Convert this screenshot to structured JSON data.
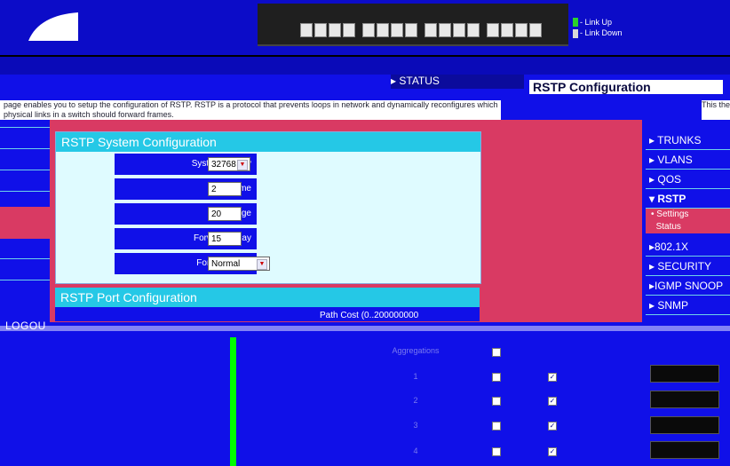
{
  "header": {
    "brand": "",
    "switch_model": "",
    "legend": {
      "link_up": "- Link Up",
      "link_down": "- Link Down"
    }
  },
  "tabs": {
    "status": "STATUS"
  },
  "page": {
    "title": "RSTP Configuration",
    "description_left": "page enables you to setup the configuration of RSTP. RSTP is a protocol that prevents loops in network and dynamically reconfigures which physical links in a switch should forward frames.",
    "description_right": "This the"
  },
  "system_config": {
    "title": "RSTP System Configuration",
    "fields": [
      {
        "label": "System Priority",
        "value": "32768",
        "type": "select"
      },
      {
        "label": "Hello Time",
        "value": "2",
        "type": "input"
      },
      {
        "label": "Max Age",
        "value": "20",
        "type": "input"
      },
      {
        "label": "Forward Delay",
        "value": "15",
        "type": "input"
      },
      {
        "label": "Force Version",
        "value": "Normal",
        "type": "select"
      }
    ]
  },
  "port_config": {
    "title": "RSTP Port Configuration",
    "path_cost_header": "Path Cost (0..200000000",
    "rows": [
      {
        "port": "Aggregations",
        "enabled": false,
        "edge": false,
        "cost": ""
      },
      {
        "port": "1",
        "enabled": false,
        "edge": true,
        "cost": ""
      },
      {
        "port": "2",
        "enabled": false,
        "edge": true,
        "cost": ""
      },
      {
        "port": "3",
        "enabled": false,
        "edge": true,
        "cost": ""
      },
      {
        "port": "4",
        "enabled": false,
        "edge": true,
        "cost": ""
      }
    ]
  },
  "nav": {
    "items": [
      {
        "label": "TRUNKS"
      },
      {
        "label": "VLANS"
      },
      {
        "label": "QOS"
      },
      {
        "label": "RSTP"
      },
      {
        "label": "802.1X"
      },
      {
        "label": "SECURITY"
      },
      {
        "label": "IGMP SNOOP"
      },
      {
        "label": "SNMP"
      }
    ],
    "sub_items": [
      {
        "label": "Settings"
      },
      {
        "label": "Status"
      }
    ]
  },
  "logout": "LOGOU",
  "colors": {
    "accent": "#25c8e6",
    "pink": "#d93a63",
    "blue": "#1010e8"
  }
}
